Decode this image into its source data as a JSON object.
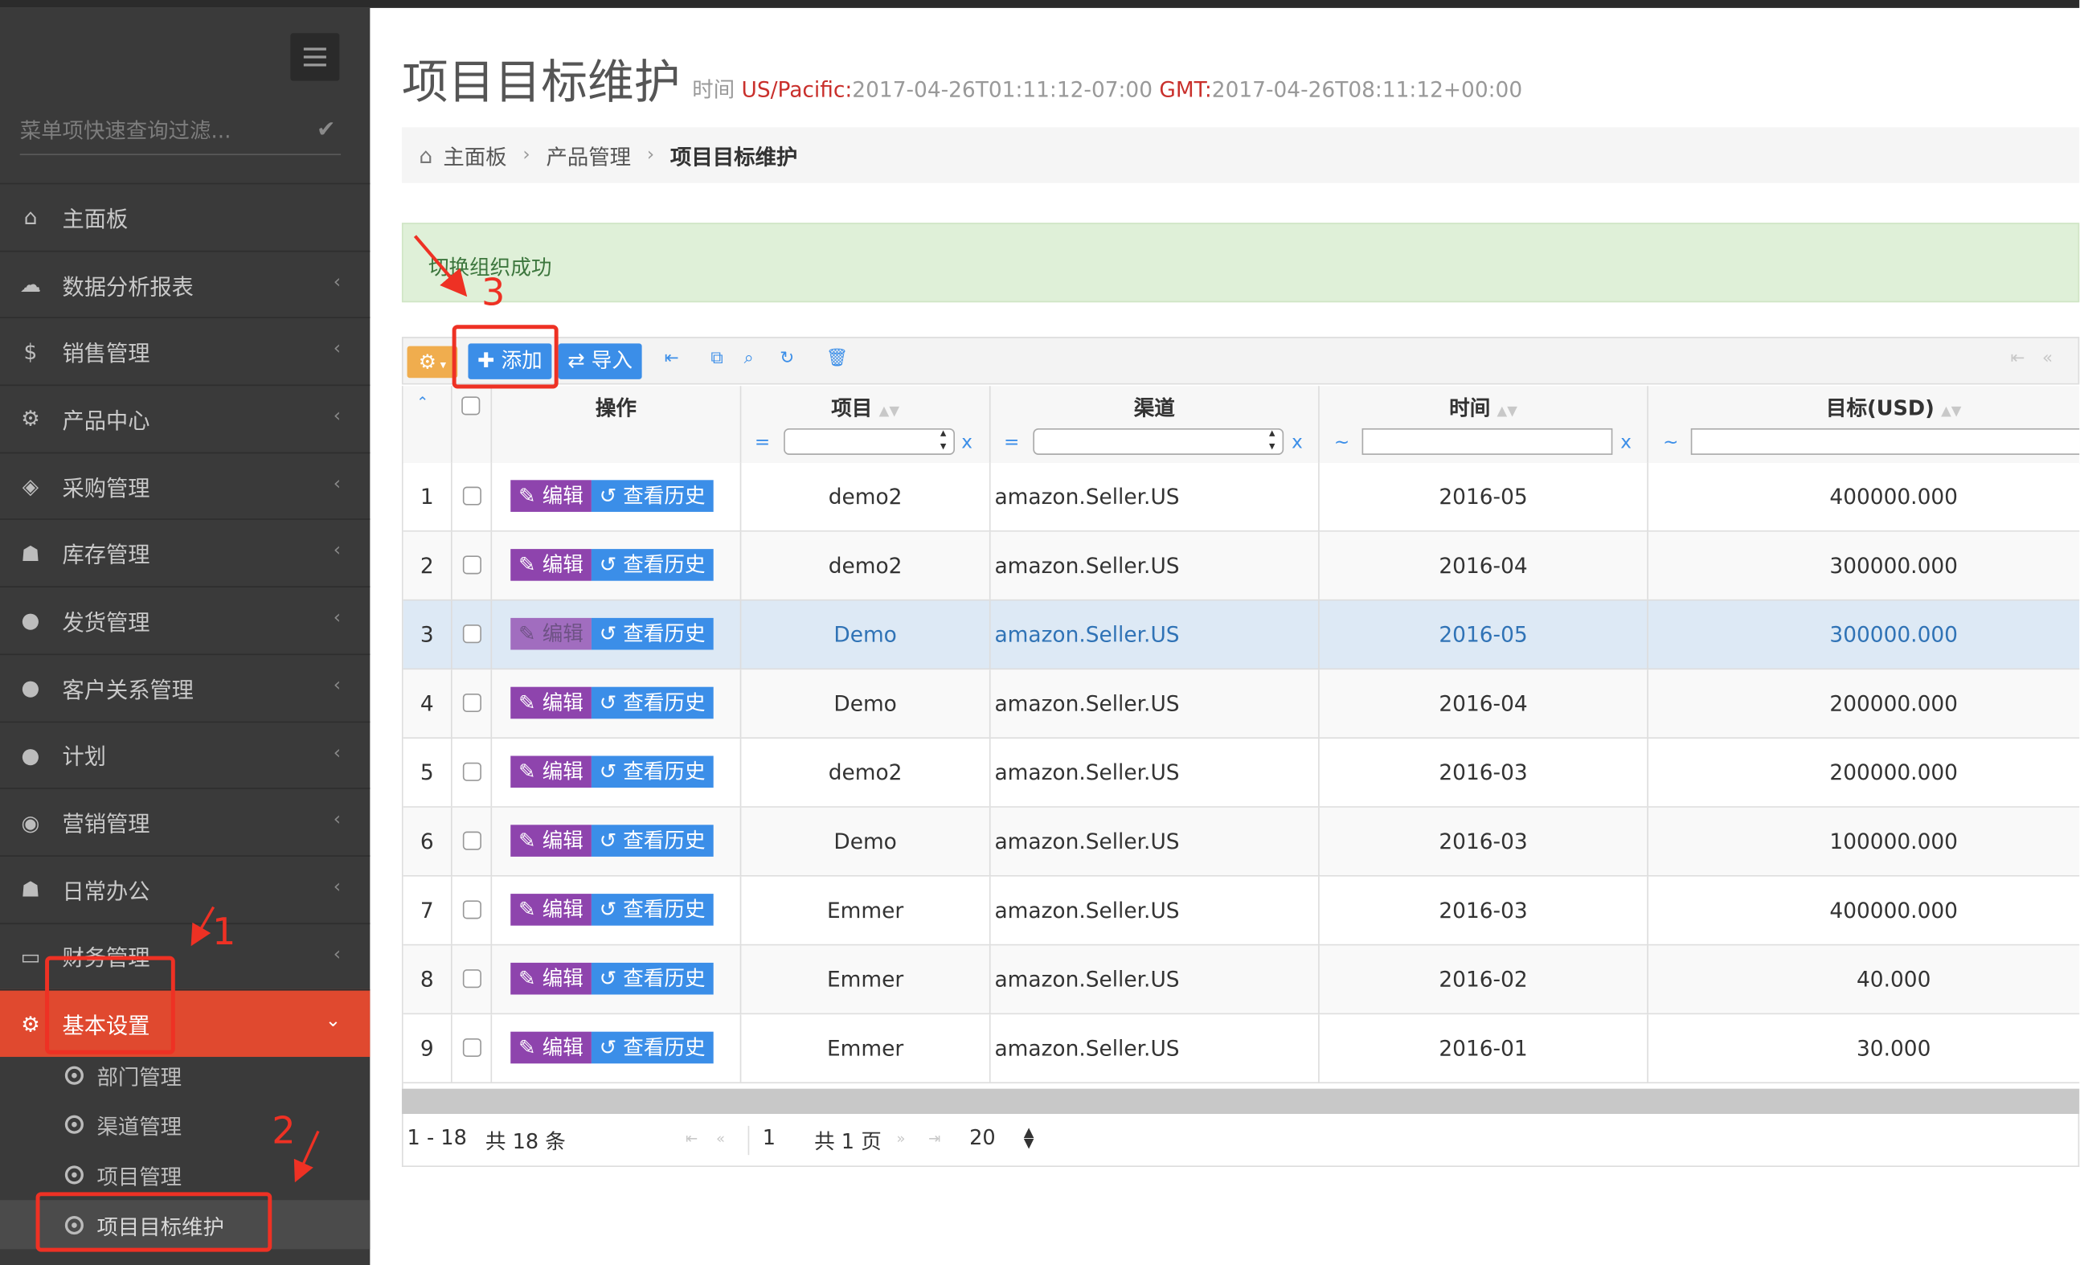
{
  "sidebar": {
    "filter_placeholder": "菜单项快速查询过滤...",
    "items": [
      {
        "label": "主面板",
        "icon": "home-icon",
        "glyph": "⌂",
        "chevron": ""
      },
      {
        "label": "数据分析报表",
        "icon": "cloud-icon",
        "glyph": "☁",
        "chevron": "‹"
      },
      {
        "label": "销售管理",
        "icon": "dollar-icon",
        "glyph": "$",
        "chevron": "‹"
      },
      {
        "label": "产品中心",
        "icon": "gears-icon",
        "glyph": "⚙",
        "chevron": "‹"
      },
      {
        "label": "采购管理",
        "icon": "cube-icon",
        "glyph": "◈",
        "chevron": "‹"
      },
      {
        "label": "库存管理",
        "icon": "android-icon",
        "glyph": "☗",
        "chevron": "‹"
      },
      {
        "label": "发货管理",
        "icon": "circle-icon",
        "glyph": "●",
        "chevron": "‹"
      },
      {
        "label": "客户关系管理",
        "icon": "circle-icon",
        "glyph": "●",
        "chevron": "‹"
      },
      {
        "label": "计划",
        "icon": "circle-icon",
        "glyph": "●",
        "chevron": "‹"
      },
      {
        "label": "营销管理",
        "icon": "bullseye-icon",
        "glyph": "◉",
        "chevron": "‹"
      },
      {
        "label": "日常办公",
        "icon": "android-icon",
        "glyph": "☗",
        "chevron": "‹"
      },
      {
        "label": "财务管理",
        "icon": "credit-card-icon",
        "glyph": "▭",
        "chevron": "‹"
      },
      {
        "label": "基本设置",
        "icon": "gears-icon",
        "glyph": "⚙",
        "chevron": "⌄"
      }
    ],
    "subitems": [
      "部门管理",
      "渠道管理",
      "项目管理",
      "项目目标维护"
    ]
  },
  "header": {
    "title": "项目目标维护",
    "time_label": "时间",
    "tz1": "US/Pacific:",
    "time1": "2017-04-26T01:11:12-07:00",
    "tz2": "GMT:",
    "time2": "2017-04-26T08:11:12+00:00"
  },
  "breadcrumb": [
    "主面板",
    "产品管理",
    "项目目标维护"
  ],
  "alert": {
    "text": "切换组织成功"
  },
  "toolbar": {
    "add_label": "添加",
    "import_label": "导入"
  },
  "table": {
    "columns": {
      "ops": "操作",
      "project": "项目",
      "channel": "渠道",
      "time": "时间",
      "target": "目标(USD)"
    },
    "filter_ops": {
      "eq": "=",
      "range": "~",
      "clear": "x"
    },
    "edit_label": "编辑",
    "history_label": "查看历史",
    "rows": [
      {
        "no": "1",
        "project": "demo2",
        "channel": "amazon.Seller.US",
        "time": "2016-05",
        "target": "400000.000"
      },
      {
        "no": "2",
        "project": "demo2",
        "channel": "amazon.Seller.US",
        "time": "2016-04",
        "target": "300000.000"
      },
      {
        "no": "3",
        "project": "Demo",
        "channel": "amazon.Seller.US",
        "time": "2016-05",
        "target": "300000.000"
      },
      {
        "no": "4",
        "project": "Demo",
        "channel": "amazon.Seller.US",
        "time": "2016-04",
        "target": "200000.000"
      },
      {
        "no": "5",
        "project": "demo2",
        "channel": "amazon.Seller.US",
        "time": "2016-03",
        "target": "200000.000"
      },
      {
        "no": "6",
        "project": "Demo",
        "channel": "amazon.Seller.US",
        "time": "2016-03",
        "target": "100000.000"
      },
      {
        "no": "7",
        "project": "Emmer",
        "channel": "amazon.Seller.US",
        "time": "2016-03",
        "target": "400000.000"
      },
      {
        "no": "8",
        "project": "Emmer",
        "channel": "amazon.Seller.US",
        "time": "2016-02",
        "target": "40.000"
      },
      {
        "no": "9",
        "project": "Emmer",
        "channel": "amazon.Seller.US",
        "time": "2016-01",
        "target": "30.000"
      }
    ]
  },
  "pager": {
    "range": "1 - 18",
    "total": "共 18 条",
    "page": "1",
    "pages": "共 1 页",
    "page_size": "20"
  },
  "annotations": {
    "n1": "1",
    "n2": "2",
    "n3": "3"
  },
  "colors": {
    "accent": "#e0492f",
    "primary": "#3b8ee8",
    "edit": "#8e44ad",
    "annotation": "#ee3124"
  }
}
